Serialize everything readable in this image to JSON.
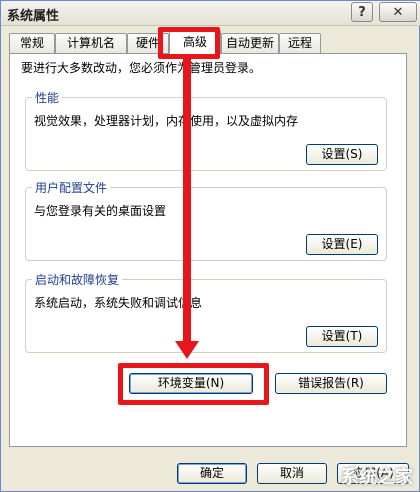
{
  "window": {
    "title": "系统属性"
  },
  "titlebar_buttons": {
    "help": "?",
    "close": "✕"
  },
  "tabs": [
    {
      "label": "常规"
    },
    {
      "label": "计算机名"
    },
    {
      "label": "硬件"
    },
    {
      "label": "高级"
    },
    {
      "label": "自动更新"
    },
    {
      "label": "远程"
    }
  ],
  "panel": {
    "notice": "要进行大多数改动，您必须作为管理员登录。",
    "performance": {
      "title": "性能",
      "desc": "视觉效果，处理器计划，内存使用，以及虚拟内存",
      "button": "设置(S)"
    },
    "user_profiles": {
      "title": "用户配置文件",
      "desc": "与您登录有关的桌面设置",
      "button": "设置(E)"
    },
    "startup_recovery": {
      "title": "启动和故障恢复",
      "desc": "系统启动，系统失败和调试信息",
      "button": "设置(T)"
    },
    "env_button": "环境变量(N)",
    "error_button": "错误报告(R)"
  },
  "footer": {
    "ok": "确定",
    "cancel": "取消",
    "apply": "应用(A)"
  },
  "annotation": {
    "color": "#e8161b"
  },
  "watermark": "系统之家"
}
